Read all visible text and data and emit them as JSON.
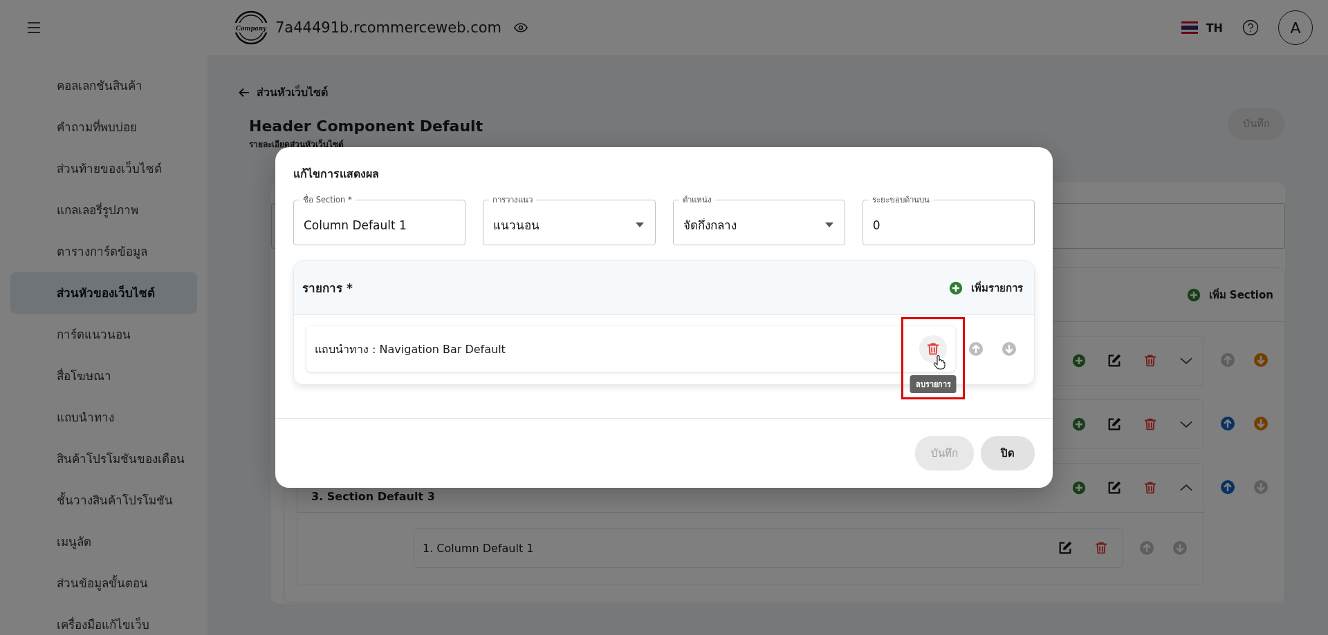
{
  "header": {
    "logo_text": "Company",
    "site_name": "7a44491b.rcommerceweb.com",
    "language": "TH",
    "avatar": "A"
  },
  "sidebar": {
    "items": [
      {
        "label": "คอลเลกชันสินค้า",
        "selected": false
      },
      {
        "label": "คำถามที่พบบ่อย",
        "selected": false
      },
      {
        "label": "ส่วนท้ายของเว็บไซต์",
        "selected": false
      },
      {
        "label": "แกลเลอรี่รูปภาพ",
        "selected": false
      },
      {
        "label": "ตารางการ์ดข้อมูล",
        "selected": false
      },
      {
        "label": "ส่วนหัวของเว็บไซต์",
        "selected": true
      },
      {
        "label": "การ์ดแนวนอน",
        "selected": false
      },
      {
        "label": "สื่อโฆษณา",
        "selected": false
      },
      {
        "label": "แถบนำทาง",
        "selected": false
      },
      {
        "label": "สินค้าโปรโมชันของเดือน",
        "selected": false
      },
      {
        "label": "ชั้นวางสินค้าโปรโมชัน",
        "selected": false
      },
      {
        "label": "เมนูลัด",
        "selected": false
      },
      {
        "label": "ส่วนข้อมูลขั้นตอน",
        "selected": false
      },
      {
        "label": "เครื่องมือแก้ไขเว็บ",
        "selected": false
      }
    ]
  },
  "page": {
    "back_link": "ส่วนหัวเว็บไซต์",
    "title": "Header Component Default",
    "subtitle": "รายละเอียดส่วนหัวเว็บไซต์",
    "save_button": {
      "label": "บันทึก",
      "disabled": true
    },
    "sections": {
      "add_label": "เพิ่ม Section",
      "rows": [
        {
          "up_enabled": false,
          "down_enabled": true,
          "expanded": false
        },
        {
          "up_enabled": true,
          "down_enabled": true,
          "expanded": false
        },
        {
          "title": "3. Section Default 3",
          "up_enabled": true,
          "down_enabled": false,
          "expanded": true,
          "columns": [
            {
              "label": "1. Column Default 1",
              "up_enabled": false,
              "down_enabled": false
            }
          ]
        }
      ]
    }
  },
  "dialog": {
    "title": "แก้ไขการแสดงผล",
    "fields": [
      {
        "label": "ชื่อ Section *",
        "value": "Column Default 1",
        "kind": "text"
      },
      {
        "label": "การวางแนว",
        "value": "แนวนอน",
        "kind": "select"
      },
      {
        "label": "ตำแหน่ง",
        "value": "จัดกึ่งกลาง",
        "kind": "select"
      },
      {
        "label": "ระยะขอบด้านบน",
        "value": "0",
        "kind": "text"
      }
    ],
    "items_panel": {
      "title": "รายการ *",
      "add_label": "เพิ่มรายการ",
      "items": [
        {
          "label": "แถบนำทาง : Navigation Bar Default",
          "hovered": true,
          "tooltip": "ลบรายการ",
          "up_enabled": false,
          "down_enabled": false
        }
      ]
    },
    "buttons": [
      {
        "label": "บันทึก",
        "kind": "save",
        "disabled": true
      },
      {
        "label": "ปิด",
        "kind": "close",
        "disabled": false
      }
    ]
  }
}
